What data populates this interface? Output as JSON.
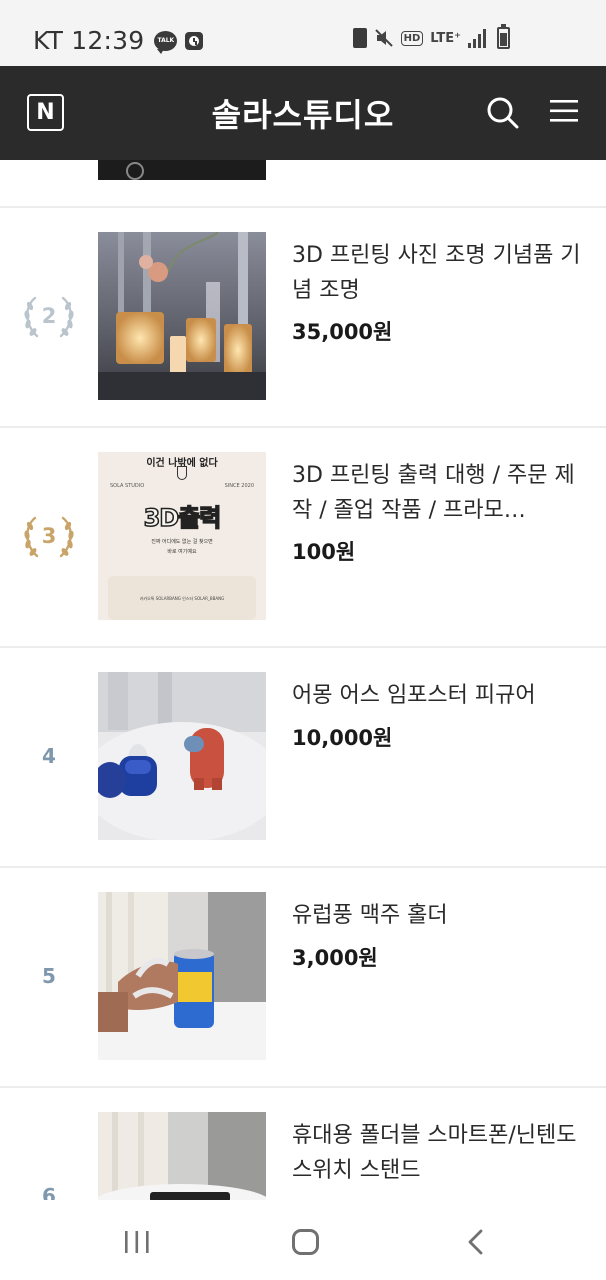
{
  "status_bar": {
    "carrier_time": "KT 12:39",
    "talk_label": "TALK",
    "hd_label": "HD",
    "lte_label": "LTE⁺"
  },
  "header": {
    "logo_letter": "N",
    "title": "솔라스튜디오"
  },
  "products": [
    {
      "rank": "2",
      "rank_style": "silver-laurel",
      "name": "3D 프린팅 사진 조명 기념품 기념 조명",
      "price": "35,000원",
      "image": "lamp-photo"
    },
    {
      "rank": "3",
      "rank_style": "gold-laurel",
      "name": "3D 프린팅 출력 대행 / 주문 제작 / 졸업 작품 / 프라모…",
      "price": "100원",
      "image": "3d-print-poster"
    },
    {
      "rank": "4",
      "rank_style": "plain",
      "name": "어몽 어스 임포스터 피규어",
      "price": "10,000원",
      "image": "among-us-figures"
    },
    {
      "rank": "5",
      "rank_style": "plain",
      "name": "유럽풍 맥주 홀더",
      "price": "3,000원",
      "image": "beer-holder"
    },
    {
      "rank": "6",
      "rank_style": "plain",
      "name": "휴대용 폴더블 스마트폰/닌텐도 스위치 스탠드",
      "price": "",
      "image": "phone-stand"
    }
  ],
  "poster": {
    "headline": "이건 나밖에 없다",
    "brand": "SOLA STUDIO",
    "since": "SINCE 2020",
    "big_text": "3D출력",
    "line1": "진짜 어디에도 없는 걸 찾으면",
    "line2": "바로 여기예요",
    "contact": "카카오톡 SOLARBANG 인스타 SOLAR_BBANG"
  },
  "colors": {
    "header_bg": "#2b2b2b",
    "rank_plain": "#7f98ad",
    "silver": "#b9c4cc",
    "gold": "#c9a468"
  }
}
